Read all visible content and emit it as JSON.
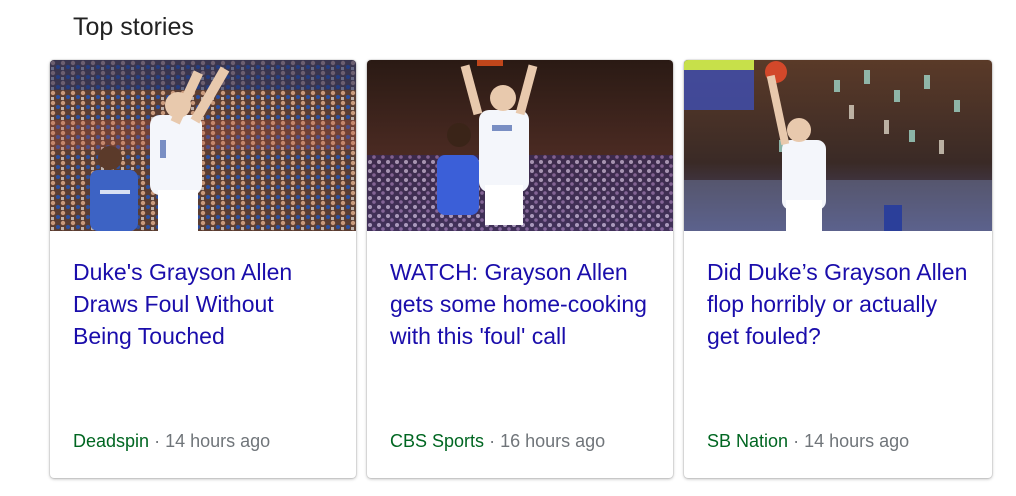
{
  "section": {
    "title": "Top stories"
  },
  "cards": [
    {
      "headline": "Duke's Grayson Allen Draws Foul Without Being Touched",
      "source": "Deadspin",
      "time": "14 hours ago",
      "image_icon": "basketball-photo"
    },
    {
      "headline": "WATCH: Grayson Allen gets some home-cooking with this 'foul' call",
      "source": "CBS Sports",
      "time": "16 hours ago",
      "image_icon": "basketball-photo"
    },
    {
      "headline": "Did Duke’s Grayson Allen flop horribly or actually get fouled?",
      "source": "SB Nation",
      "time": "14 hours ago",
      "image_icon": "basketball-photo"
    }
  ],
  "separator": "·",
  "colors": {
    "headline": "#1a0dab",
    "source": "#006621",
    "time": "#70757a",
    "title": "#222222"
  }
}
